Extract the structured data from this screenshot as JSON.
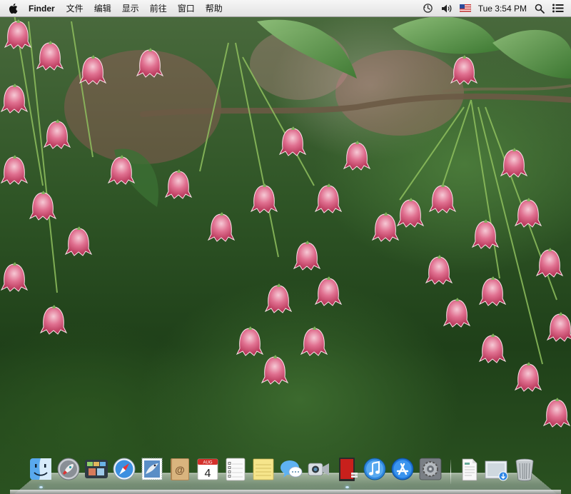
{
  "menubar": {
    "app_name": "Finder",
    "menus": [
      "文件",
      "编辑",
      "显示",
      "前往",
      "窗口",
      "帮助"
    ],
    "clock": "Tue 3:54 PM",
    "status_icons": [
      "time-machine-icon",
      "volume-icon",
      "input-source-flag-icon",
      "spotlight-search-icon",
      "notification-center-icon"
    ]
  },
  "dock": {
    "calendar_month": "AUG",
    "calendar_day": "4",
    "items": [
      "finder",
      "launchpad",
      "mission-control",
      "safari",
      "mail",
      "contacts",
      "calendar",
      "reminders",
      "notes",
      "messages",
      "facetime",
      "photo-booth",
      "itunes",
      "app-store",
      "system-preferences",
      "document-stack",
      "downloads-stack",
      "trash"
    ]
  },
  "colors": {
    "flower_pink": "#d84a6e",
    "flower_light": "#f4c7d3",
    "foliage_green": "#3f7a34",
    "branch_brown": "#6b5a45"
  }
}
